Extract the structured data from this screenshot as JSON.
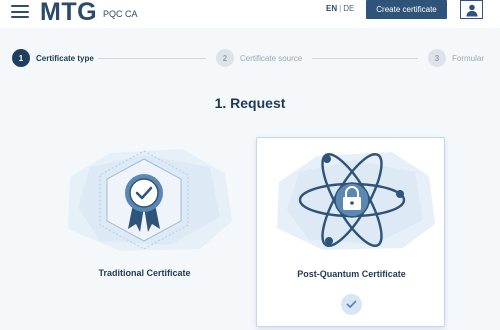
{
  "header": {
    "brand": "MTG",
    "brand_sub": "PQC CA",
    "lang_active": "EN",
    "lang_separator": "|",
    "lang_inactive": "DE",
    "create_button_label": "Create certificate",
    "menu_icon": "hamburger-menu-icon",
    "user_icon": "user-icon"
  },
  "stepper": {
    "steps": [
      {
        "number": "1",
        "label": "Certificate type",
        "state": "active"
      },
      {
        "number": "2",
        "label": "Certificate source",
        "state": "inactive"
      },
      {
        "number": "3",
        "label": "Formular",
        "state": "inactive"
      }
    ]
  },
  "main": {
    "title": "1. Request",
    "cards": [
      {
        "label": "Traditional Certificate",
        "icon": "award-badge-icon",
        "selected": false
      },
      {
        "label": "Post-Quantum Certificate",
        "icon": "atom-lock-icon",
        "selected": true,
        "check_icon": "check-icon"
      }
    ]
  },
  "colors": {
    "primary": "#2f5479",
    "accent_light": "#d7e6f4",
    "text": "#1f3a56",
    "inactive": "#93a1ae"
  }
}
